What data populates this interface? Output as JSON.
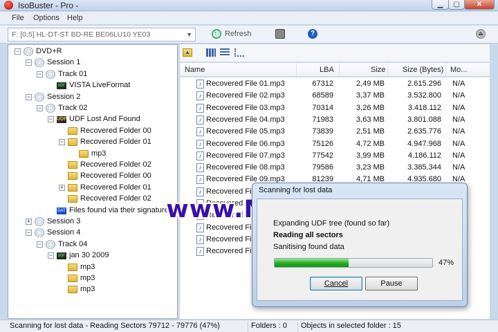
{
  "window": {
    "title": "IsoBuster - Pro -"
  },
  "menu": [
    "File",
    "Options",
    "Help"
  ],
  "toolbar": {
    "drive": "F: [0,5]  HL-DT-ST  BD-RE  BE06LU10   YE03",
    "refresh_label": "Refresh"
  },
  "tree": [
    {
      "label": "DVD+R",
      "depth": 0,
      "icon": "disc-drive-icon",
      "expander": "minus"
    },
    {
      "label": "Session 1",
      "depth": 1,
      "icon": "disc-icon",
      "expander": "minus"
    },
    {
      "label": "Track 01",
      "depth": 2,
      "icon": "disc-icon",
      "expander": "minus"
    },
    {
      "label": "VISTA LiveFormat",
      "depth": 3,
      "icon": "filesystem-badge-icon",
      "expander": "none"
    },
    {
      "label": "Session 2",
      "depth": 1,
      "icon": "disc-icon",
      "expander": "minus"
    },
    {
      "label": "Track 02",
      "depth": 2,
      "icon": "disc-icon",
      "expander": "minus"
    },
    {
      "label": "UDF Lost And Found",
      "depth": 3,
      "icon": "udf-icon",
      "expander": "minus"
    },
    {
      "label": "Recovered Folder 00",
      "depth": 4,
      "icon": "folder-icon",
      "expander": "none"
    },
    {
      "label": "Recovered Folder 01",
      "depth": 4,
      "icon": "folder-icon",
      "expander": "minus"
    },
    {
      "label": "mp3",
      "depth": 5,
      "icon": "folder-icon",
      "expander": "none"
    },
    {
      "label": "Recovered Folder 02",
      "depth": 4,
      "icon": "folder-icon",
      "expander": "none"
    },
    {
      "label": "Recovered Folder 00",
      "depth": 4,
      "icon": "folder-icon",
      "expander": "none"
    },
    {
      "label": "Recovered Folder 01",
      "depth": 4,
      "icon": "folder-icon",
      "expander": "plus"
    },
    {
      "label": "Recovered Folder 02",
      "depth": 4,
      "icon": "folder-icon",
      "expander": "none"
    },
    {
      "label": "Files found via their signature",
      "depth": 3,
      "icon": "signature-files-icon",
      "expander": "none"
    },
    {
      "label": "Session 3",
      "depth": 1,
      "icon": "disc-icon",
      "expander": "plus"
    },
    {
      "label": "Session 4",
      "depth": 1,
      "icon": "disc-icon",
      "expander": "minus"
    },
    {
      "label": "Track 04",
      "depth": 2,
      "icon": "disc-icon",
      "expander": "minus"
    },
    {
      "label": "jan 30 2009",
      "depth": 3,
      "icon": "filesystem-badge-icon",
      "expander": "minus"
    },
    {
      "label": "mp3",
      "depth": 4,
      "icon": "folder-icon",
      "expander": "none"
    },
    {
      "label": "mp3",
      "depth": 4,
      "icon": "folder-icon",
      "expander": "none"
    },
    {
      "label": "mp3",
      "depth": 4,
      "icon": "folder-icon",
      "expander": "none"
    }
  ],
  "list": {
    "columns": [
      "Name",
      "LBA",
      "Size",
      "Size (Bytes)",
      "Mo..."
    ],
    "rows": [
      {
        "name": "Recovered File 01.mp3",
        "lba": "67312",
        "size": "2,49 MB",
        "bytes": "2.615.296",
        "mod": "N/A"
      },
      {
        "name": "Recovered File 02.mp3",
        "lba": "68589",
        "size": "3,37 MB",
        "bytes": "3.532.800",
        "mod": "N/A"
      },
      {
        "name": "Recovered File 03.mp3",
        "lba": "70314",
        "size": "3,26 MB",
        "bytes": "3.418.112",
        "mod": "N/A"
      },
      {
        "name": "Recovered File 04.mp3",
        "lba": "71983",
        "size": "3,63 MB",
        "bytes": "3.801.088",
        "mod": "N/A"
      },
      {
        "name": "Recovered File 05.mp3",
        "lba": "73839",
        "size": "2,51 MB",
        "bytes": "2.635.776",
        "mod": "N/A"
      },
      {
        "name": "Recovered File 06.mp3",
        "lba": "75126",
        "size": "4,72 MB",
        "bytes": "4.947.968",
        "mod": "N/A"
      },
      {
        "name": "Recovered File 07.mp3",
        "lba": "77542",
        "size": "3,99 MB",
        "bytes": "4.186.112",
        "mod": "N/A"
      },
      {
        "name": "Recovered File 08.mp3",
        "lba": "79586",
        "size": "3,23 MB",
        "bytes": "3.385.344",
        "mod": "N/A"
      },
      {
        "name": "Recovered File 09.mp3",
        "lba": "81239",
        "size": "4,71 MB",
        "bytes": "4.935.680",
        "mod": "N/A"
      },
      {
        "name": "Recovered File",
        "lba": "",
        "size": "",
        "bytes": "",
        "mod": ""
      },
      {
        "name": "Recovered File",
        "lba": "",
        "size": "",
        "bytes": "",
        "mod": ""
      },
      {
        "name": "Recovered File",
        "lba": "",
        "size": "",
        "bytes": "",
        "mod": ""
      },
      {
        "name": "Recovered File",
        "lba": "",
        "size": "",
        "bytes": "",
        "mod": ""
      },
      {
        "name": "Recovered File",
        "lba": "",
        "size": "",
        "bytes": "",
        "mod": ""
      },
      {
        "name": "Recovered File",
        "lba": "",
        "size": "",
        "bytes": "",
        "mod": ""
      }
    ]
  },
  "watermark": "www.MyFileCR.com",
  "dialog": {
    "title": "Scanning for lost data",
    "line1": "Expanding UDF tree (found so far)",
    "line2": "Reading all sectors",
    "line3": "Sanitising found data",
    "progress": 47,
    "progress_label": "47%",
    "cancel_label": "Cancel",
    "pause_label": "Pause"
  },
  "status": {
    "message": "Scanning for lost data - Reading Sectors 79712 - 79776  (47%)",
    "folders": "Folders : 0",
    "objects": "Objects in selected folder : 15"
  },
  "colors": {
    "progress": "#1fae1f",
    "watermark": "#3a10a8"
  }
}
